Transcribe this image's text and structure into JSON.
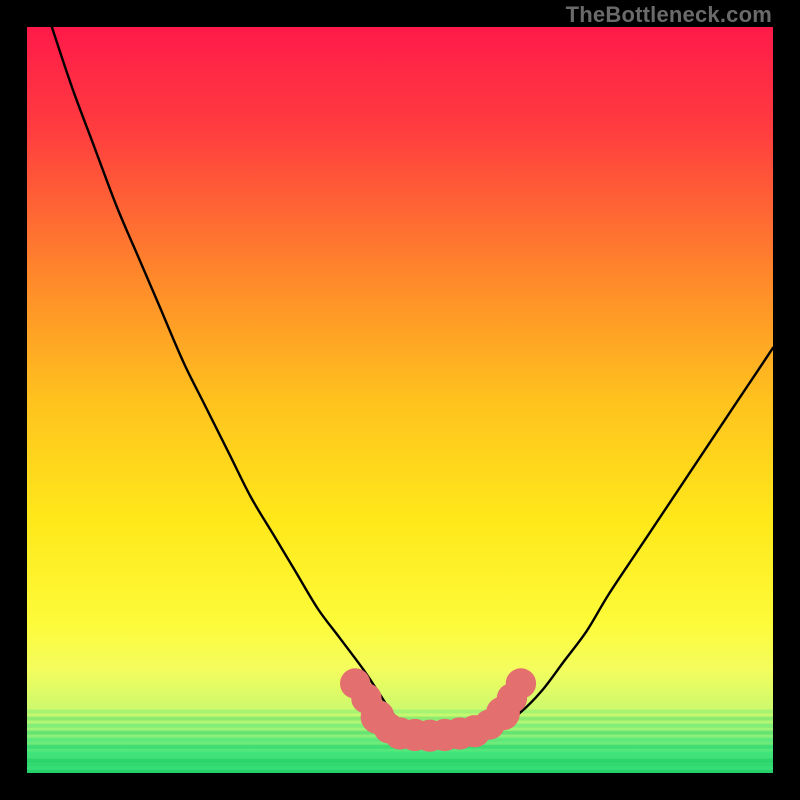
{
  "watermark": "TheBottleneck.com",
  "colors": {
    "black": "#000000",
    "curve": "#000000",
    "marker_fill": "#e46f6f",
    "marker_stroke": "#cf5a5a",
    "green_band_top": "#3be27e",
    "green_band_bottom": "#21cf67"
  },
  "chart_data": {
    "type": "line",
    "title": "",
    "xlabel": "",
    "ylabel": "",
    "xlim": [
      0,
      100
    ],
    "ylim": [
      0,
      100
    ],
    "gradient_stops": [
      {
        "pct": 0,
        "color": "#ff1a49"
      },
      {
        "pct": 14,
        "color": "#ff3d3f"
      },
      {
        "pct": 34,
        "color": "#ff8a2a"
      },
      {
        "pct": 50,
        "color": "#ffc21e"
      },
      {
        "pct": 66,
        "color": "#ffe81a"
      },
      {
        "pct": 80,
        "color": "#fdfb3a"
      },
      {
        "pct": 86,
        "color": "#f4fd5d"
      },
      {
        "pct": 92,
        "color": "#c9f96f"
      },
      {
        "pct": 95,
        "color": "#8df07a"
      },
      {
        "pct": 97,
        "color": "#4fe77c"
      },
      {
        "pct": 100,
        "color": "#21cf67"
      }
    ],
    "series": [
      {
        "name": "bottleneck-curve",
        "x": [
          0,
          3,
          6,
          9,
          12,
          15,
          18,
          21,
          24,
          27,
          30,
          33,
          36,
          39,
          42,
          45,
          47,
          49,
          51,
          53,
          55,
          57,
          59,
          61,
          63,
          66,
          69,
          72,
          75,
          78,
          82,
          86,
          90,
          94,
          98,
          100
        ],
        "y": [
          110,
          101,
          92,
          84,
          76,
          69,
          62,
          55,
          49,
          43,
          37,
          32,
          27,
          22,
          18,
          14,
          11,
          8,
          6,
          5,
          5,
          5,
          5,
          5,
          6,
          8,
          11,
          15,
          19,
          24,
          30,
          36,
          42,
          48,
          54,
          57
        ]
      }
    ],
    "markers": [
      {
        "x": 44.0,
        "y": 12.0,
        "r": 1.2
      },
      {
        "x": 45.5,
        "y": 10.0,
        "r": 1.2
      },
      {
        "x": 47.0,
        "y": 7.5,
        "r": 1.4
      },
      {
        "x": 48.5,
        "y": 6.0,
        "r": 1.2
      },
      {
        "x": 50.0,
        "y": 5.3,
        "r": 1.3
      },
      {
        "x": 52.0,
        "y": 5.1,
        "r": 1.3
      },
      {
        "x": 54.0,
        "y": 5.0,
        "r": 1.3
      },
      {
        "x": 56.0,
        "y": 5.1,
        "r": 1.3
      },
      {
        "x": 58.0,
        "y": 5.3,
        "r": 1.3
      },
      {
        "x": 60.0,
        "y": 5.6,
        "r": 1.3
      },
      {
        "x": 62.0,
        "y": 6.5,
        "r": 1.2
      },
      {
        "x": 63.8,
        "y": 8.0,
        "r": 1.4
      },
      {
        "x": 65.0,
        "y": 10.0,
        "r": 1.2
      },
      {
        "x": 66.2,
        "y": 12.0,
        "r": 1.2
      }
    ]
  }
}
